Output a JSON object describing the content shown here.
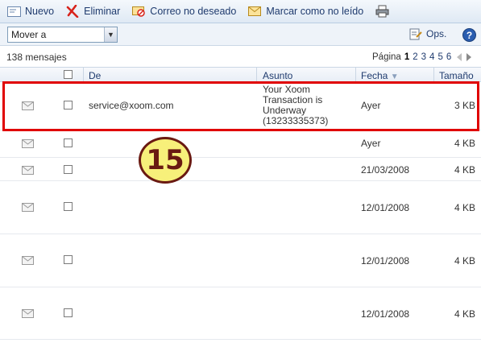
{
  "toolbar": {
    "new_label": "Nuevo",
    "delete_label": "Eliminar",
    "junk_label": "Correo no deseado",
    "mark_unread_label": "Marcar como no leído"
  },
  "actions": {
    "move_to": "Mover a",
    "options_label": "Ops.",
    "help_label": "?"
  },
  "list": {
    "count_label": "138 mensajes",
    "page_label": "Página",
    "pages": [
      "1",
      "2",
      "3",
      "4",
      "5",
      "6"
    ],
    "current_page": "1",
    "columns": {
      "from": "De",
      "subject": "Asunto",
      "date": "Fecha",
      "size": "Tamaño"
    },
    "rows": [
      {
        "from": "service@xoom.com",
        "subject": "Your Xoom Transaction is Underway (13233335373)",
        "date": "Ayer",
        "size": "3 KB"
      },
      {
        "from": "",
        "subject": "",
        "date": "Ayer",
        "size": "4 KB"
      },
      {
        "from": "",
        "subject": "",
        "date": "21/03/2008",
        "size": "4 KB"
      },
      {
        "from": "",
        "subject": "",
        "date": "12/01/2008",
        "size": "4 KB"
      },
      {
        "from": "",
        "subject": "",
        "date": "12/01/2008",
        "size": "4 KB"
      },
      {
        "from": "",
        "subject": "",
        "date": "12/01/2008",
        "size": "4 KB"
      }
    ]
  },
  "annotation": {
    "number": "15"
  },
  "colors": {
    "highlight": "#e00000",
    "badge_fill": "#f7f07a",
    "badge_text": "#6a1a12"
  }
}
